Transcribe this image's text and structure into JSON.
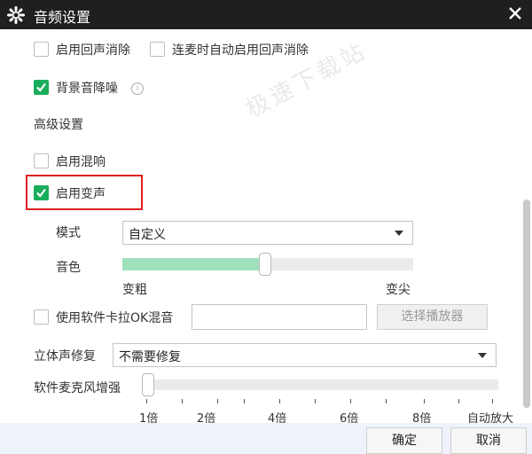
{
  "window": {
    "title": "音频设置"
  },
  "watermark": "极速下载站",
  "echo": {
    "cancel_label": "启用回声消除",
    "cancel_checked": false,
    "mic_cancel_label": "连麦时自动启用回声消除",
    "mic_cancel_checked": false
  },
  "denoise": {
    "label": "背景音降噪",
    "checked": true,
    "info_icon": "info-icon"
  },
  "advanced": {
    "heading": "高级设置"
  },
  "reverb": {
    "label": "启用混响",
    "checked": false
  },
  "voice_change": {
    "label": "启用变声",
    "checked": true,
    "mode_label": "模式",
    "mode_value": "自定义",
    "tone_label": "音色",
    "tone_level": 0.49,
    "tone_min_label": "变粗",
    "tone_max_label": "变尖"
  },
  "karaoke": {
    "label": "使用软件卡拉OK混音",
    "checked": false,
    "player_value": "",
    "select_player_label": "选择播放器"
  },
  "stereo": {
    "label": "立体声修复",
    "value": "不需要修复"
  },
  "mic_boost": {
    "label": "软件麦克风增强",
    "level": 0.0,
    "ticks": [
      "1倍",
      "2倍",
      "4倍",
      "6倍",
      "8倍",
      "自动放大"
    ]
  },
  "footer": {
    "ok_label": "确定",
    "cancel_label": "取消"
  },
  "colors": {
    "accent": "#1aad5b",
    "slider_fill": "#9fe0bd",
    "title_bar": "#1f1f1f",
    "highlight": "#e02020"
  }
}
